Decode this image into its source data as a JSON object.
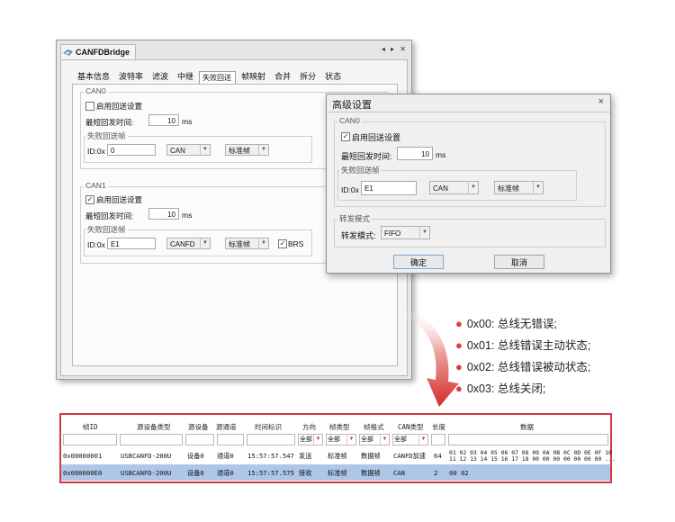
{
  "window": {
    "title": "CANFDBridge",
    "controls": "◂ ▸ ✕",
    "tabs": [
      "基本信息",
      "波特率",
      "滤波",
      "中继",
      "失败回送",
      "帧映射",
      "合并",
      "拆分",
      "状态"
    ],
    "selected_tab": "失败回送",
    "can0": {
      "group_label": "CAN0",
      "enable_label": "启用回送设置",
      "enable_checked": false,
      "min_resend_label": "最短回发时间:",
      "min_resend_value": "10",
      "unit": "ms",
      "fail_frame_label": "失败回送帧",
      "id_label": "ID:0x",
      "id_value": "0",
      "type_value": "CAN",
      "format_value": "标准帧"
    },
    "can1": {
      "group_label": "CAN1",
      "enable_label": "启用回送设置",
      "enable_checked": true,
      "min_resend_label": "最短回发时间:",
      "min_resend_value": "10",
      "unit": "ms",
      "fail_frame_label": "失败回送帧",
      "id_label": "ID:0x",
      "id_value": "E1",
      "type_value": "CANFD",
      "format_value": "标准帧",
      "brs_label": "BRS",
      "brs_checked": true
    }
  },
  "dialog": {
    "title": "高级设置",
    "close": "×",
    "can0": {
      "group_label": "CAN0",
      "enable_label": "启用回送设置",
      "enable_checked": true,
      "min_resend_label": "最短回发时间:",
      "min_resend_value": "10",
      "unit": "ms",
      "fail_frame_label": "失败回送帧",
      "id_label": "ID:0x",
      "id_value": "E1",
      "type_value": "CAN",
      "format_value": "标准帧"
    },
    "forward": {
      "group_label": "转发模式",
      "label": "转发模式:",
      "value": "FIFO"
    },
    "ok_label": "确定",
    "cancel_label": "取消"
  },
  "status_list": [
    "0x00: 总线无错误;",
    "0x01: 总线错误主动状态;",
    "0x02: 总线错误被动状态;",
    "0x03: 总线关闭;"
  ],
  "table": {
    "headers": [
      "帧ID",
      "源设备类型",
      "源设备",
      "源通道",
      "时间标识",
      "方向",
      "帧类型",
      "帧格式",
      "CAN类型",
      "长度",
      "数据"
    ],
    "filters": [
      "",
      "",
      "",
      "",
      "",
      "全部",
      "全部",
      "全部",
      "全部",
      "",
      ""
    ],
    "rows": [
      [
        "0x00000001",
        "USBCANFD-200U",
        "设备0",
        "通道0",
        "15:57:57.547",
        "发送",
        "标准帧",
        "数据帧",
        "CANFD加速",
        "64",
        "01 02 03 04 05 06 07 08 09 0A 0B 0C 0D 0E 0F 10",
        "11 12 13 14 15 16 17 18 00 00 00 00 00 00 00 ..."
      ],
      [
        "0x000000E0",
        "USBCANFD-200U",
        "设备0",
        "通道0",
        "15:57:57.575",
        "接收",
        "标准帧",
        "数据帧",
        "CAN",
        "2",
        "00 02",
        ""
      ]
    ]
  },
  "colors": {
    "accent_red": "#d5393b",
    "selected_row": "#aec7e8"
  }
}
